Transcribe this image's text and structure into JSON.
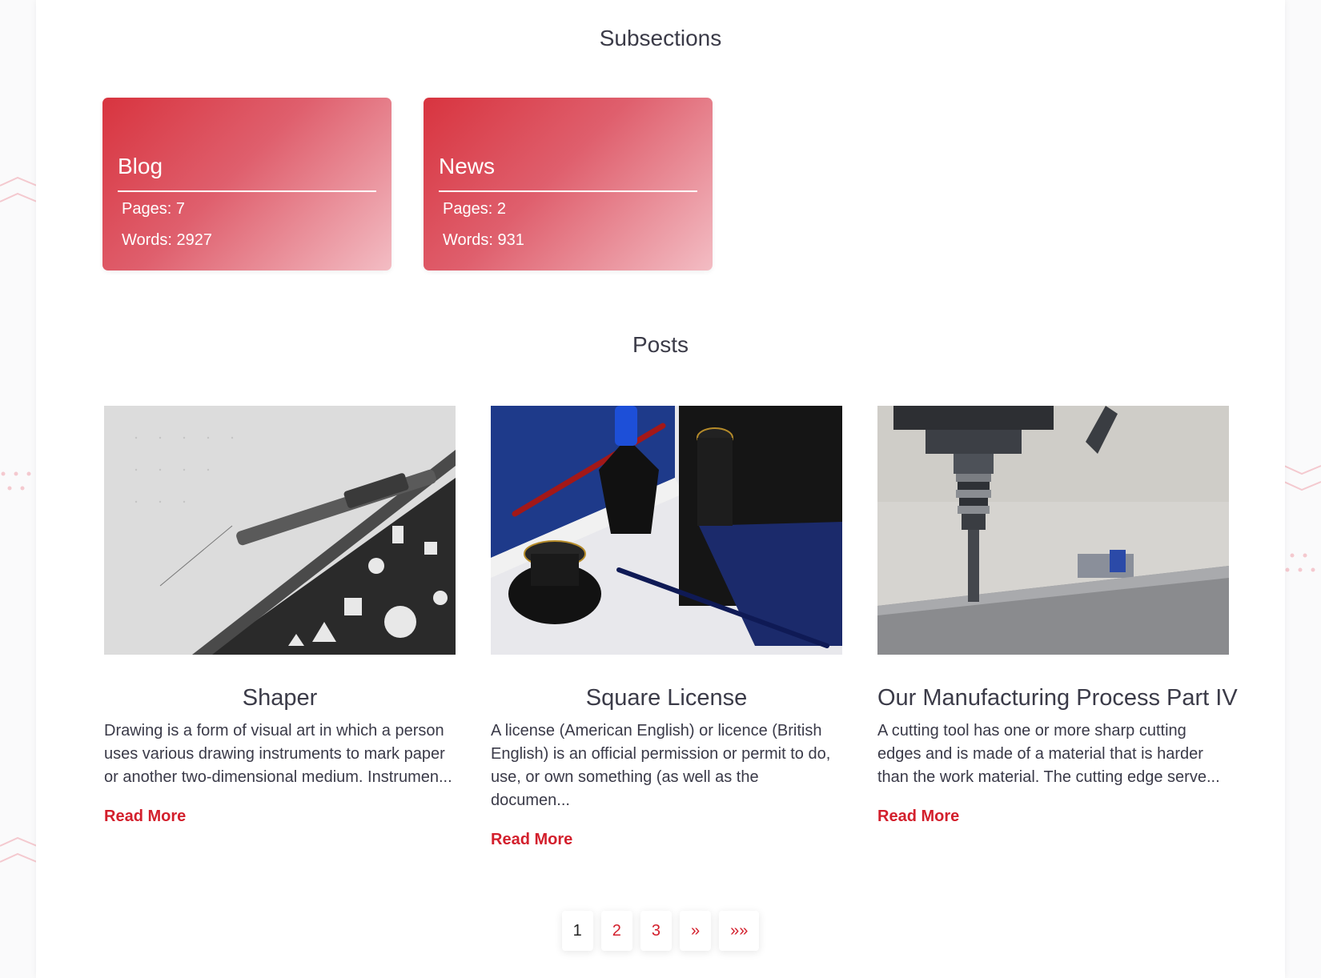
{
  "subsections": {
    "heading": "Subsections",
    "cards": [
      {
        "name": "Blog",
        "pages": "Pages: 7",
        "words": "Words: 2927"
      },
      {
        "name": "News",
        "pages": "Pages: 2",
        "words": "Words: 931"
      }
    ]
  },
  "posts": {
    "heading": "Posts",
    "items": [
      {
        "title": "Shaper",
        "excerpt": "Drawing is a form of visual art in which a person uses various drawing instruments to mark paper or another two-dimensional medium. Instrumen...",
        "read_more": "Read More",
        "image_icon": "pencil-stencil-photo"
      },
      {
        "title": "Square License",
        "excerpt": "A license (American English) or licence (British English) is an official permission or permit to do, use, or own something (as well as the documen...",
        "read_more": "Read More",
        "image_icon": "stamp-ink-pen-photo"
      },
      {
        "title": "Our Manufacturing Process Part IV",
        "excerpt": "A cutting tool has one or more sharp cutting edges and is made of a material that is harder than the work material. The cutting edge serve...",
        "read_more": "Read More",
        "image_icon": "milling-machine-photo"
      }
    ]
  },
  "pagination": {
    "current": "1",
    "pages": [
      "2",
      "3"
    ],
    "next": "»",
    "last": "»»"
  },
  "colors": {
    "accent": "#d31f2c",
    "card_gradient_start": "#d8343f",
    "card_gradient_end": "#f3bdc4"
  }
}
